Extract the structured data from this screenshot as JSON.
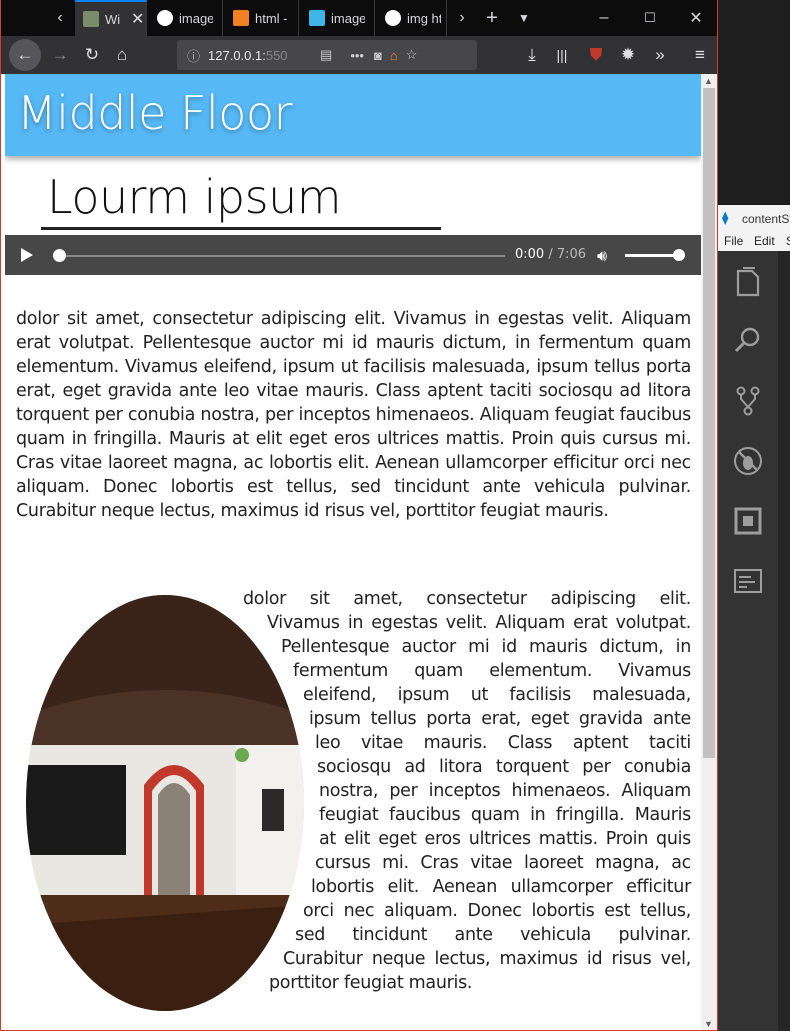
{
  "tabs": [
    {
      "title": "Wi",
      "favicon_color": "#7a8c6a",
      "active": true
    },
    {
      "title": "image",
      "favicon_color": "#ffffff"
    },
    {
      "title": "html -",
      "favicon_color": "#f48024"
    },
    {
      "title": "image",
      "favicon_color": "#3fb6e8"
    },
    {
      "title": "img ht",
      "favicon_color": "#ffffff"
    }
  ],
  "tab_close_glyph": "✕",
  "address": {
    "url_prefix": "127.0.0.1:",
    "url_dim": "550"
  },
  "page": {
    "header_title": "Middle Floor",
    "subtitle": "Lourm ipsum",
    "audio": {
      "current": "0:00",
      "separator": " / ",
      "duration": "7:06",
      "progress": 0,
      "volume": 1.0
    },
    "paragraph1": "dolor sit amet, consectetur adipiscing elit. Vivamus in egestas velit. Aliquam erat volutpat. Pellentesque auctor mi id mauris dictum, in fermentum quam elementum. Vivamus eleifend, ipsum ut facilisis malesuada, ipsum tellus porta erat, eget gravida ante leo vitae mauris. Class aptent taciti sociosqu ad litora torquent per conubia nostra, per inceptos himenaeos. Aliquam feugiat faucibus quam in fringilla. Mauris at elit eget eros ultrices mattis. Proin quis cursus mi. Cras vitae laoreet magna, ac lobortis elit. Aenean ullamcorper efficitur orci nec aliquam. Donec lobortis est tellus, sed tincidunt ante vehicula pulvinar. Curabitur neque lectus, maximus id risus vel, porttitor feugiat mauris.",
    "paragraph2_lines": [
      "dolor sit amet, consectetur adipiscing elit.",
      "Vivamus in egestas velit. Aliquam erat volutpat.",
      "Pellentesque auctor mi id mauris dictum, in",
      "fermentum quam elementum. Vivamus",
      "eleifend, ipsum ut facilisis malesuada,",
      "ipsum tellus porta erat, eget gravida ante",
      "leo vitae mauris. Class aptent taciti",
      "sociosqu ad litora torquent per conubia",
      "nostra, per inceptos himenaeos. Aliquam",
      "feugiat faucibus quam in fringilla. Mauris",
      "at elit eget eros ultrices mattis. Proin quis",
      "cursus mi. Cras vitae laoreet magna, ac",
      "lobortis elit. Aenean ullamcorper efficitur",
      "orci nec aliquam. Donec lobortis est tellus,",
      "sed tincidunt ante vehicula pulvinar.",
      "Curabitur neque lectus, maximus id risus vel,",
      "porttitor feugiat mauris."
    ]
  },
  "vscode": {
    "title": "contentSt",
    "menu": [
      "File",
      "Edit",
      "S"
    ],
    "activity_icons": [
      "explorer-icon",
      "search-icon",
      "source-control-icon",
      "debug-icon",
      "extensions-icon",
      "outline-icon"
    ]
  },
  "colors": {
    "header": "#56b8f5",
    "audio_bar": "#474747",
    "browser_chrome": "#323234",
    "accent": "#0a84ff"
  }
}
